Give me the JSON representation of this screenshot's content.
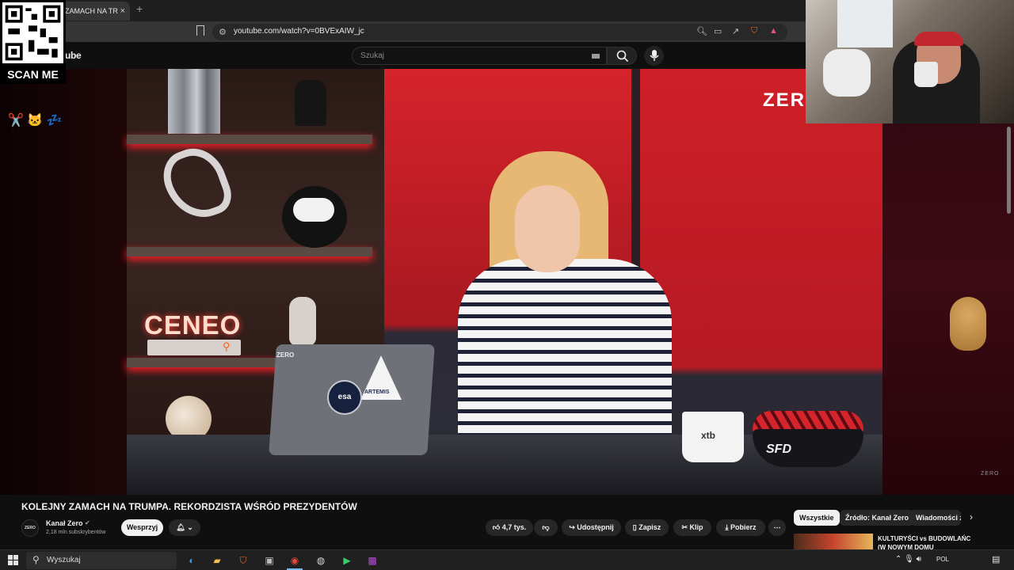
{
  "browser": {
    "tab_title": "ZAMACH NA TR",
    "tab_close": "×",
    "new_tab": "+",
    "url": "youtube.com/watch?v=0BVExAIW_jc"
  },
  "youtube": {
    "logo_text": "ube",
    "search_placeholder": "Szukaj"
  },
  "video": {
    "studio_sign": "ZER",
    "corner_brand": "ZERO",
    "shelf_brand": "CENEO",
    "laptop_brand": "ZERO",
    "sticker_esa": "esa",
    "sticker_artemis": "ARTEMIS",
    "mug_brand": "xtb",
    "bowl_brand": "SFD"
  },
  "overlay": {
    "scan_label": "SCAN ME"
  },
  "watch": {
    "title": "KOLEJNY ZAMACH NA TRUMPA. REKORDZISTA WŚRÓD PREZYDENTÓW",
    "channel_avatar_text": "ZERO",
    "channel_name": "Kanał Zero",
    "subscribers": "2,18 mln subskrybentów",
    "support_label": "Wesprzyj",
    "like_count": "4,7 tys.",
    "share_label": "Udostępnij",
    "save_label": "Zapisz",
    "clip_label": "Klip",
    "download_label": "Pobierz"
  },
  "sidebar": {
    "chips": [
      "Wszystkie",
      "Źródło: Kanał Zero",
      "Wiadomości z"
    ],
    "recommended_title": "KULTURYŚCI vs BUDOWLAŃC (W NOWYM DOMU"
  },
  "taskbar": {
    "search_placeholder": "Wyszukaj",
    "language": "POL"
  }
}
